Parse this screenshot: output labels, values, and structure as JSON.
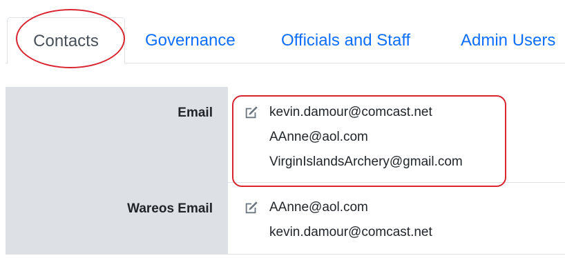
{
  "tabs": [
    {
      "label": "Contacts",
      "active": true
    },
    {
      "label": "Governance",
      "active": false
    },
    {
      "label": "Officials and Staff",
      "active": false
    },
    {
      "label": "Admin Users",
      "active": false
    }
  ],
  "rows": [
    {
      "label": "Email",
      "values": [
        "kevin.damour@comcast.net",
        "AAnne@aol.com",
        "VirginIslandsArchery@gmail.com"
      ]
    },
    {
      "label": "Wareos Email",
      "values": [
        "AAnne@aol.com",
        "kevin.damour@comcast.net"
      ]
    }
  ],
  "icons": {
    "edit": "edit-icon"
  },
  "colors": {
    "link": "#0d6efd",
    "annotation": "#d9232e",
    "label_bg": "#dde1e6"
  }
}
